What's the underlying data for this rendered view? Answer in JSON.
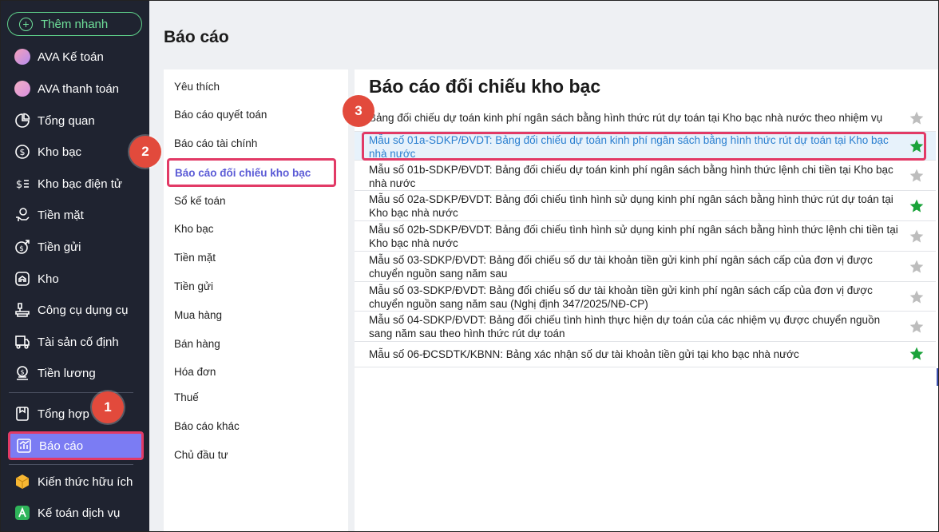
{
  "sidebar": {
    "quick_add": "Thêm nhanh",
    "items": [
      {
        "label": "AVA Kế toán",
        "icon": "avatar-icon"
      },
      {
        "label": "AVA thanh toán",
        "icon": "avatar-icon"
      },
      {
        "label": "Tổng quan",
        "icon": "pie-chart-icon"
      },
      {
        "label": "Kho bạc",
        "icon": "dollar-coin-icon"
      },
      {
        "label": "Kho bạc điện tử",
        "icon": "digital-dollar-icon"
      },
      {
        "label": "Tiền mặt",
        "icon": "cash-hand-icon"
      },
      {
        "label": "Tiền gửi",
        "icon": "deposit-icon"
      },
      {
        "label": "Kho",
        "icon": "warehouse-icon"
      },
      {
        "label": "Công cụ dụng cụ",
        "icon": "tools-icon"
      },
      {
        "label": "Tài sản cố định",
        "icon": "truck-icon"
      },
      {
        "label": "Tiền lương",
        "icon": "salary-icon"
      },
      {
        "label": "Tổng hợp",
        "icon": "summary-icon"
      },
      {
        "label": "Báo cáo",
        "icon": "report-chart-icon"
      },
      {
        "label": "Kiến thức hữu ích",
        "icon": "knowledge-cube-icon"
      },
      {
        "label": "Kế toán dịch vụ",
        "icon": "service-icon"
      }
    ]
  },
  "header": {
    "title": "Báo cáo"
  },
  "categories": [
    "Yêu thích",
    "Báo cáo quyết toán",
    "Báo cáo tài chính",
    "Báo cáo đối chiếu kho bạc",
    "Sổ kế toán",
    "Kho bạc",
    "Tiền mặt",
    "Tiền gửi",
    "Mua hàng",
    "Bán hàng",
    "Hóa đơn",
    "Thuế",
    "Báo cáo khác",
    "Chủ đầu tư"
  ],
  "reports": {
    "title": "Báo cáo đối chiếu kho bạc",
    "items": [
      {
        "text": "Bảng đối chiếu dự toán kinh phí ngân sách bằng hình thức rút dự toán tại Kho bạc nhà nước theo nhiệm vụ",
        "favorite": false
      },
      {
        "text": "Mẫu số 01a-SDKP/ĐVDT: Bảng đối chiếu dự toán kinh phí ngân sách bằng hình thức rút dự toán tại Kho bạc nhà nước",
        "favorite": true
      },
      {
        "text": "Mẫu số 01b-SDKP/ĐVDT: Bảng đối chiếu dự toán kinh phí ngân sách bằng hình thức lệnh chi tiền tại Kho bạc nhà nước",
        "favorite": false
      },
      {
        "text": "Mẫu số 02a-SDKP/ĐVDT: Bảng đối chiếu tình hình sử dụng kinh phí ngân sách bằng hình thức rút dự toán tại Kho bạc nhà nước",
        "favorite": true
      },
      {
        "text": "Mẫu số 02b-SDKP/ĐVDT: Bảng đối chiếu tình hình sử dụng kinh phí ngân sách bằng hình thức lệnh chi tiền tại Kho bạc nhà nước",
        "favorite": false
      },
      {
        "text": "Mẫu số 03-SDKP/ĐVDT: Bảng đối chiếu số dư tài khoản tiền gửi kinh phí ngân sách cấp của đơn vị được chuyển nguồn sang năm sau",
        "favorite": false
      },
      {
        "text": "Mẫu số 03-SDKP/ĐVDT: Bảng đối chiếu số dư tài khoản tiền gửi kinh phí ngân sách cấp của đơn vị được chuyển nguồn sang năm sau (Nghị định 347/2025/NĐ-CP)",
        "favorite": false
      },
      {
        "text": "Mẫu số 04-SDKP/ĐVDT: Bảng đối chiếu tình hình thực hiện dự toán của các nhiệm vụ được chuyển nguồn sang năm sau theo hình thức rút dự toán",
        "favorite": false
      },
      {
        "text": "Mẫu số 06-ĐCSDTK/KBNN: Bảng xác nhận số dư tài khoản tiền gửi tại kho bạc nhà nước",
        "favorite": true
      }
    ]
  },
  "steps": [
    "1",
    "2",
    "3"
  ],
  "colors": {
    "sidebar_bg": "#1f2330",
    "active_nav": "#7b7cf3",
    "highlight": "#e23a66",
    "badge": "#e24a3c",
    "star_on": "#1aa33a",
    "star_off": "#bdbdbd",
    "link": "#2a7fd0"
  }
}
